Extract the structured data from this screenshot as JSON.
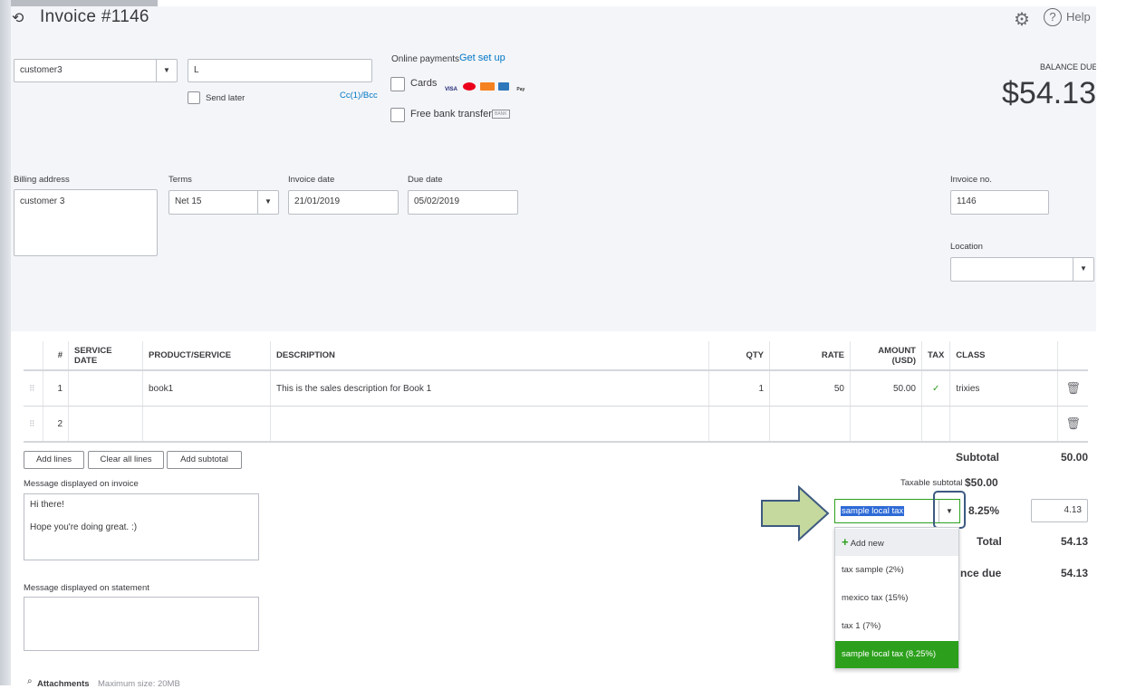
{
  "header": {
    "title": "Invoice #1146",
    "help_label": "Help",
    "balance_due_label": "BALANCE DUE",
    "balance_due_value": "$54.13"
  },
  "customer": {
    "value": "customer3",
    "email_value": "L",
    "send_later_label": "Send later",
    "cc_bcc": "Cc(1)/Bcc"
  },
  "online_payments": {
    "label": "Online payments",
    "setup_link": "Get set up",
    "cards_label": "Cards",
    "card_logos": [
      "VISA",
      "MC",
      "DISC",
      "AMEX",
      "Pay"
    ],
    "bank_label": "Free bank transfer",
    "bank_badge": "BANK"
  },
  "billing": {
    "billing_address_label": "Billing address",
    "billing_address_value": "customer 3",
    "terms_label": "Terms",
    "terms_value": "Net 15",
    "invoice_date_label": "Invoice date",
    "invoice_date_value": "21/01/2019",
    "due_date_label": "Due date",
    "due_date_value": "05/02/2019",
    "invoice_no_label": "Invoice no.",
    "invoice_no_value": "1146",
    "location_label": "Location",
    "location_value": ""
  },
  "table": {
    "headers": [
      "#",
      "SERVICE DATE",
      "PRODUCT/SERVICE",
      "DESCRIPTION",
      "QTY",
      "RATE",
      "AMOUNT (USD)",
      "TAX",
      "CLASS"
    ],
    "rows": [
      {
        "num": "1",
        "service_date": "",
        "product": "book1",
        "description": "This is the sales description for Book 1",
        "qty": "1",
        "rate": "50",
        "amount": "50.00",
        "tax": "✓",
        "class": "trixies"
      },
      {
        "num": "2",
        "service_date": "",
        "product": "",
        "description": "",
        "qty": "",
        "rate": "",
        "amount": "",
        "tax": "",
        "class": ""
      }
    ]
  },
  "actions": {
    "add_lines": "Add lines",
    "clear_all_lines": "Clear all lines",
    "add_subtotal": "Add subtotal"
  },
  "messages": {
    "invoice_label": "Message displayed on invoice",
    "invoice_line1": "Hi there!",
    "invoice_line2": "Hope you're doing great. :)",
    "statement_label": "Message displayed on statement",
    "attachments_label": "Attachments",
    "attachments_max": "Maximum size: 20MB"
  },
  "totals": {
    "subtotal_label": "Subtotal",
    "subtotal_value": "50.00",
    "taxable_label": "Taxable subtotal",
    "taxable_value": "$50.00",
    "tax_select_value": "sample local tax",
    "tax_rate": "8.25%",
    "tax_amount": "4.13",
    "total_label": "Total",
    "total_value": "54.13",
    "balance_label": "nce due",
    "balance_value": "54.13"
  },
  "tax_dropdown": {
    "add_new": "Add new",
    "options": [
      "tax sample (2%)",
      "mexico tax (15%)",
      "tax 1 (7%)",
      "sample local tax (8.25%)"
    ],
    "selected_index": 3
  },
  "colors": {
    "accent_green": "#2ca01c",
    "link_blue": "#0077c5",
    "highlight_blue": "#2d6ad6",
    "arrow_fill": "#c5d89e",
    "arrow_stroke": "#3d5a80"
  }
}
